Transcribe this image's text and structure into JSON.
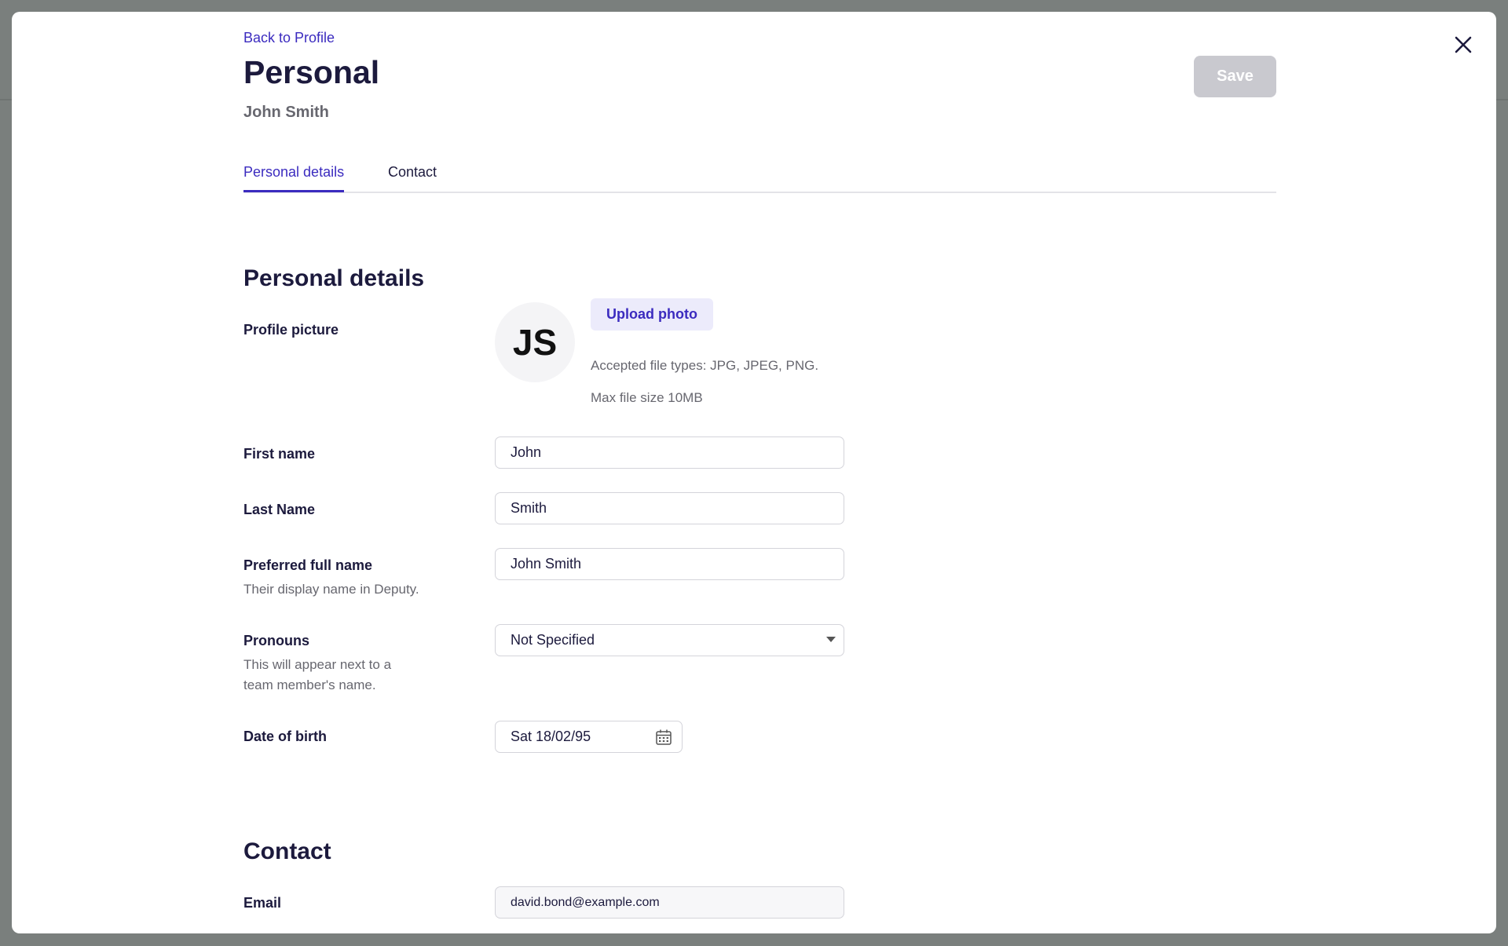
{
  "header": {
    "back_link": "Back to Profile",
    "title": "Personal",
    "subtitle": "John Smith",
    "save_label": "Save"
  },
  "tabs": [
    {
      "label": "Personal details",
      "active": true
    },
    {
      "label": "Contact",
      "active": false
    }
  ],
  "personal_details": {
    "section_title": "Personal details",
    "profile_picture": {
      "label": "Profile picture",
      "initials": "JS",
      "upload_label": "Upload photo",
      "accepted_types": "Accepted file types: JPG, JPEG, PNG.",
      "max_size": "Max file size 10MB"
    },
    "first_name": {
      "label": "First name",
      "value": "John"
    },
    "last_name": {
      "label": "Last Name",
      "value": "Smith"
    },
    "preferred_name": {
      "label": "Preferred full name",
      "help": "Their display name in Deputy.",
      "value": "John Smith"
    },
    "pronouns": {
      "label": "Pronouns",
      "help": "This will appear next to a team member's name.",
      "value": "Not Specified"
    },
    "dob": {
      "label": "Date of birth",
      "value": "Sat 18/02/95"
    }
  },
  "contact": {
    "section_title": "Contact",
    "email": {
      "label": "Email",
      "value": "david.bond@example.com"
    }
  },
  "colors": {
    "accent": "#3b2bbf",
    "text": "#1c1a3d",
    "muted": "#67676f",
    "save_disabled": "#c9c9cf"
  },
  "icons": {
    "close": "close-icon",
    "calendar": "calendar-icon",
    "caret": "chevron-down-icon"
  }
}
